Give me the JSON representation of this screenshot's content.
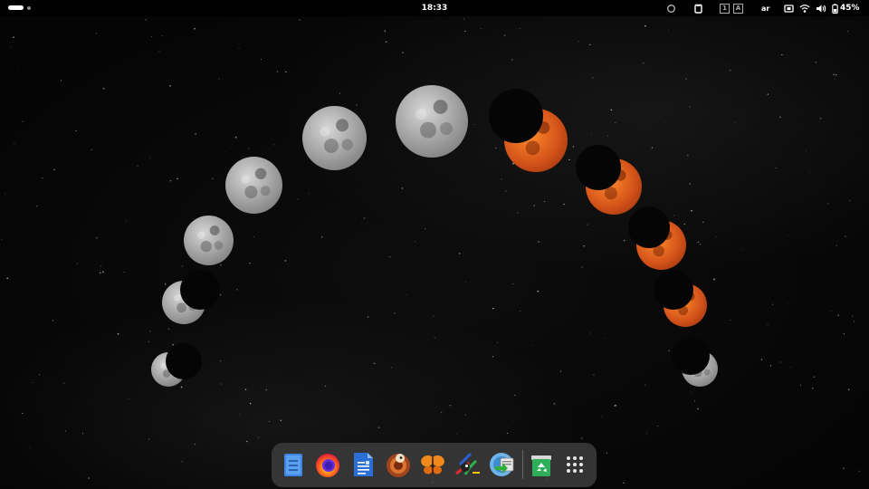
{
  "topbar": {
    "clock": "18:33",
    "keyboard_layout": "ar",
    "battery_percent_label": "45%",
    "input_method_a": "1",
    "input_method_b": "A"
  },
  "wallpaper": {
    "subject": "lunar eclipse phases",
    "grey_moon_color": "#b0b0b0",
    "red_moon_color": "#e0601c"
  },
  "dock": {
    "apps": [
      {
        "name": "Files",
        "icon": "files-icon"
      },
      {
        "name": "Firefox",
        "icon": "firefox-icon"
      },
      {
        "name": "Text Document",
        "icon": "document-icon"
      },
      {
        "name": "Bird App",
        "icon": "bird-icon"
      },
      {
        "name": "Butterfly App",
        "icon": "butterfly-icon"
      },
      {
        "name": "Paint App",
        "icon": "paint-icon"
      },
      {
        "name": "Transfer App",
        "icon": "transfer-icon"
      },
      {
        "name": "Trash",
        "icon": "trash-icon"
      },
      {
        "name": "Show Applications",
        "icon": "app-grid-icon"
      }
    ]
  }
}
